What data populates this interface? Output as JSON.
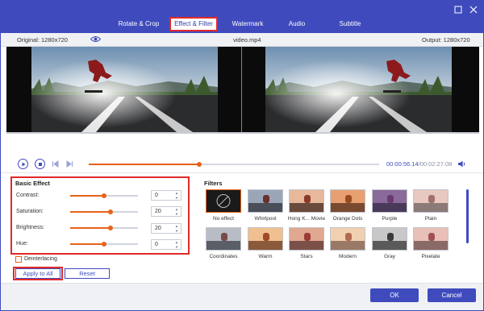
{
  "tabs": [
    {
      "label": "Rotate & Crop"
    },
    {
      "label": "Effect & Filter"
    },
    {
      "label": "Watermark"
    },
    {
      "label": "Audio"
    },
    {
      "label": "Subtitle"
    }
  ],
  "window": {
    "minimize_icon": "window-restore-icon",
    "close_icon": "close-icon"
  },
  "preview": {
    "original_label": "Original: 1280x720",
    "filename": "video.mp4",
    "output_label": "Output: 1280x720",
    "eye_icon": "eye-icon"
  },
  "player": {
    "current_time": "00:00:56.14",
    "total_time": "/00:02:27.08",
    "progress": 0.38,
    "icons": [
      "play-icon",
      "stop-icon",
      "prev-frame-icon",
      "next-frame-icon",
      "volume-icon"
    ]
  },
  "basic_effect": {
    "title": "Basic Effect",
    "sliders": [
      {
        "label": "Contrast:",
        "value": "0",
        "level": 0.5
      },
      {
        "label": "Saturation:",
        "value": "20",
        "level": 0.6
      },
      {
        "label": "Brightness:",
        "value": "20",
        "level": 0.6
      },
      {
        "label": "Hue:",
        "value": "0",
        "level": 0.5
      }
    ],
    "deinterlacing": "Deinterlacing",
    "apply_all": "Apply to All",
    "reset": "Reset"
  },
  "filters": {
    "title": "Filters",
    "items": [
      {
        "label": "No effect",
        "sky": "#1a1a1a",
        "ground": "#1a1a1a",
        "fig": "#1a1a1a",
        "selected": true
      },
      {
        "label": "Whirlpool",
        "sky": "#9aa6b8",
        "ground": "#4a4e58",
        "fig": "#6a3030"
      },
      {
        "label": "Hong K... Movie",
        "sky": "#e8b89a",
        "ground": "#6a4a3c",
        "fig": "#8a3a2a"
      },
      {
        "label": "Orange Dots",
        "sky": "#e8a070",
        "ground": "#7a4a30",
        "fig": "#9a4a20"
      },
      {
        "label": "Purple",
        "sky": "#8a6a9a",
        "ground": "#4a3a5a",
        "fig": "#6a3a6a"
      },
      {
        "label": "Plain",
        "sky": "#e8c8c0",
        "ground": "#8a7a78",
        "fig": "#a07070"
      },
      {
        "label": "Coordinates",
        "sky": "#b8bcc4",
        "ground": "#5a5e66",
        "fig": "#7a4a4a"
      },
      {
        "label": "Warm",
        "sky": "#f0c090",
        "ground": "#8a5a3a",
        "fig": "#a04a2a"
      },
      {
        "label": "Stars",
        "sky": "#e0a890",
        "ground": "#7a5048",
        "fig": "#9a3a3a"
      },
      {
        "label": "Modern",
        "sky": "#f0d0b0",
        "ground": "#9a7a66",
        "fig": "#b06a50"
      },
      {
        "label": "Gray",
        "sky": "#c8c8c8",
        "ground": "#5a5a5a",
        "fig": "#3a3a3a"
      },
      {
        "label": "Pixelate",
        "sky": "#e8c0b8",
        "ground": "#8a6a66",
        "fig": "#a05050"
      }
    ]
  },
  "footer": {
    "ok": "OK",
    "cancel": "Cancel"
  },
  "colors": {
    "brand": "#3f4bbd",
    "accent": "#e8611a",
    "highlight": "#e02a2a"
  }
}
